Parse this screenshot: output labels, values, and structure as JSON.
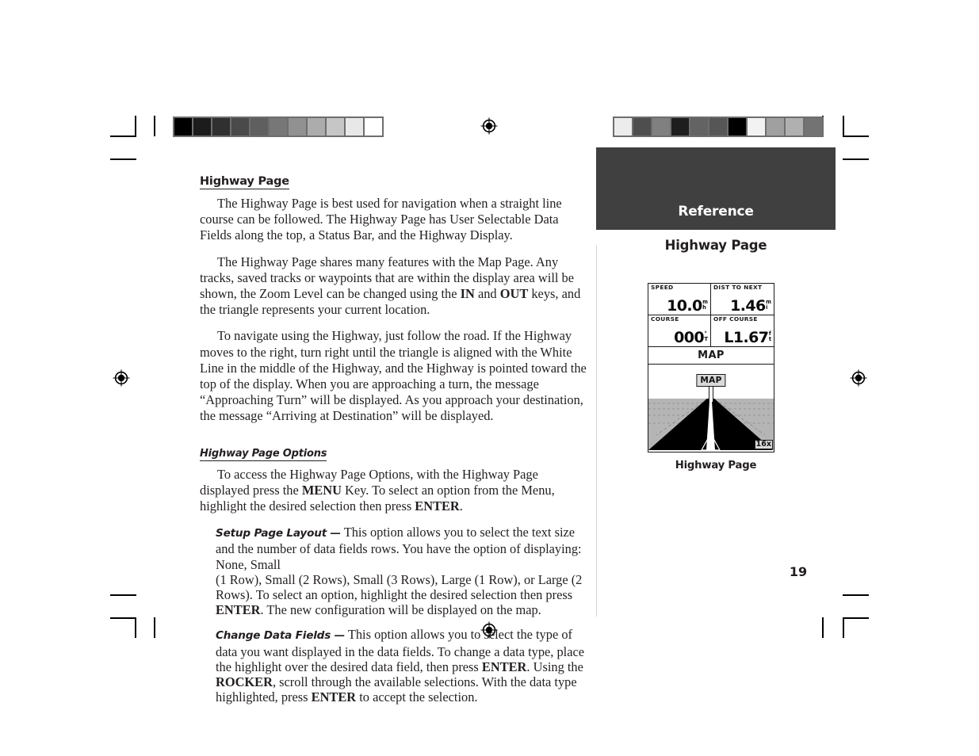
{
  "page": {
    "number": "19",
    "running_head": "Reference",
    "sidebar_title": "Highway Page",
    "figure_caption": "Highway Page"
  },
  "article": {
    "heading": "Highway Page",
    "paragraphs": [
      "The Highway Page is best used for navigation when a straight line course can be followed.  The Highway Page has User Selectable Data Fields along the top, a Status Bar, and the Highway Display.",
      "The Highway Page shares many features with the Map Page.  Any tracks, saved tracks or waypoints that are within the display area will be shown, the Zoom Level can be changed using the IN and OUT keys, and the triangle represents your current location.",
      "To navigate using the Highway, just follow the road.  If the Highway moves to the right, turn right until the triangle is aligned with the White Line in the middle of the Highway, and the Highway is pointed toward the top of the display.  When you are approaching a turn, the message “Approaching Turn” will be displayed. As you approach your destination, the message “Arriving at Destination” will be displayed."
    ],
    "subheading": "Highway Page Options",
    "options_intro": "To access the Highway Page Options, with the Highway Page displayed press the MENU Key.  To select an option from the Menu, highlight the desired selection then press ENTER.",
    "options": [
      {
        "lead": "Setup Page Layout —",
        "text": " This option allows you to select the text size and the number of data fields rows.  You have the option of displaying: None, Small (1 Row), Small (2 Rows), Small (3 Rows), Large (1 Row), or Large (2 Rows).  To select an option, highlight the desired selection then press ENTER.  The new configuration will be displayed on the map."
      },
      {
        "lead": "Change Data Fields —",
        "text": " This option allows you to select the type of data you want displayed in the data fields.  To change a data type, place the highlight over the desired data field, then press ENTER.  Using the ROCKER, scroll through the available selections.  With the data type highlighted, press ENTER to accept the selection."
      }
    ],
    "keys": {
      "in": "IN",
      "out": "OUT",
      "menu": "MENU",
      "enter": "ENTER",
      "rocker": "ROCKER"
    }
  },
  "gps_screen": {
    "data_fields": [
      {
        "label": "SPEED",
        "value": "10.0",
        "unit_top": "m",
        "unit_bottom": "h"
      },
      {
        "label": "DIST TO NEXT",
        "value": "1.46",
        "unit_top": "m",
        "unit_bottom": "i"
      },
      {
        "label": "COURSE",
        "value": "000",
        "unit_top": "°",
        "unit_bottom": "T"
      },
      {
        "label": "OFF COURSE",
        "value": "L1.67",
        "unit_top": "f",
        "unit_bottom": "t"
      }
    ],
    "status_bar": "MAP",
    "waypoint_sign": "MAP",
    "zoom_level": "16x"
  },
  "prepress": {
    "gray_strip_left": [
      "#000000",
      "#1c1c1c",
      "#303030",
      "#4a4a4a",
      "#5f5f5f",
      "#777777",
      "#919191",
      "#acacac",
      "#c6c6c6",
      "#e8e8e8",
      "#ffffff"
    ],
    "gray_strip_right": [
      "#ececec",
      "#4e4e4e",
      "#808080",
      "#1e1e1e",
      "#636363",
      "#565656",
      "#000000",
      "#f2f2f2",
      "#a0a0a0",
      "#b0b0b0",
      "#737373"
    ],
    "registration_mark": "registration-target",
    "band_color": "#404040",
    "rule_color": "#d3d3d3"
  }
}
